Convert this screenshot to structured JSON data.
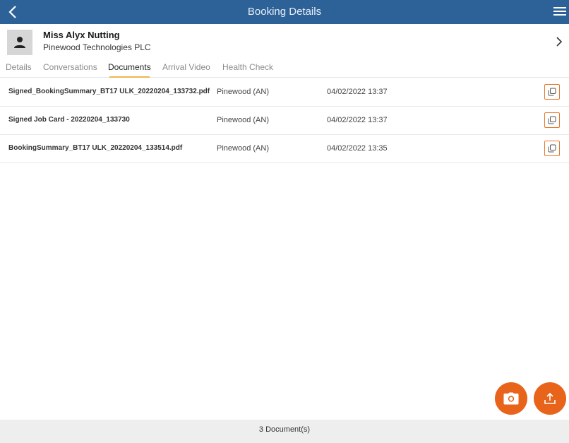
{
  "header": {
    "title": "Booking Details",
    "back_icon": "chevron-left-icon",
    "menu_icon": "hamburger-menu-icon",
    "background": "#2d6298"
  },
  "customer": {
    "name": "Miss Alyx Nutting",
    "company": "Pinewood Technologies PLC",
    "avatar_icon": "person-icon"
  },
  "tabs": [
    {
      "label": "Details",
      "active": false
    },
    {
      "label": "Conversations",
      "active": false
    },
    {
      "label": "Documents",
      "active": true
    },
    {
      "label": "Arrival Video",
      "active": false
    },
    {
      "label": "Health Check",
      "active": false
    }
  ],
  "documents": [
    {
      "name": "Signed_BookingSummary_BT17 ULK_20220204_133732.pdf",
      "owner": "Pinewood (AN)",
      "date": "04/02/2022 13:37"
    },
    {
      "name": "Signed Job Card - 20220204_133730",
      "owner": "Pinewood (AN)",
      "date": "04/02/2022 13:37"
    },
    {
      "name": "BookingSummary_BT17 ULK_20220204_133514.pdf",
      "owner": "Pinewood (AN)",
      "date": "04/02/2022 13:35"
    }
  ],
  "actions": {
    "camera_icon": "camera-icon",
    "upload_icon": "upload-icon",
    "accent": "#e8641b"
  },
  "footer": {
    "count_text": "3 Document(s)"
  }
}
